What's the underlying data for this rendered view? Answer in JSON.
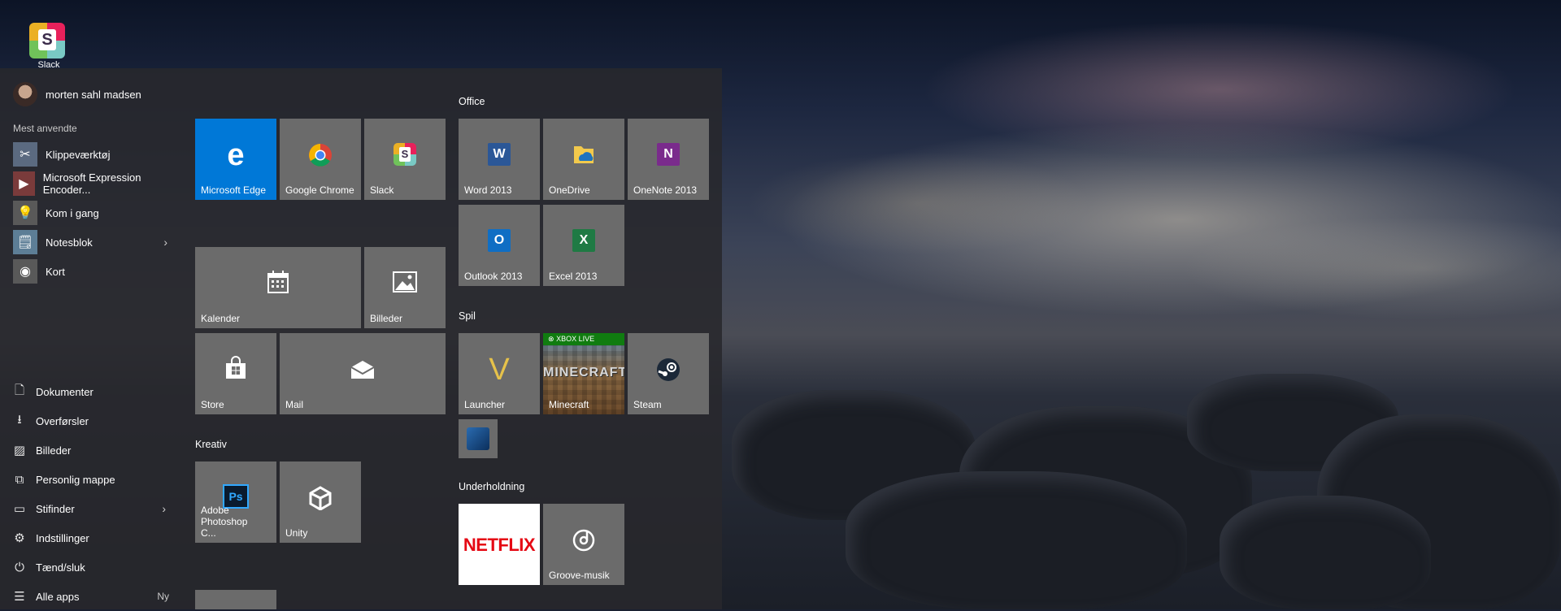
{
  "desktop": {
    "icon_label": "Slack"
  },
  "user": {
    "name": "morten sahl madsen"
  },
  "most_used": {
    "label": "Mest anvendte",
    "items": [
      {
        "label": "Klippeværktøj",
        "icon": "scissors-icon"
      },
      {
        "label": "Microsoft Expression Encoder...",
        "icon": "encoder-icon"
      },
      {
        "label": "Kom i gang",
        "icon": "lightbulb-icon"
      },
      {
        "label": "Notesblok",
        "icon": "notepad-icon"
      },
      {
        "label": "Kort",
        "icon": "map-icon"
      }
    ]
  },
  "system": {
    "items": [
      {
        "label": "Dokumenter",
        "icon": "document-icon"
      },
      {
        "label": "Overførsler",
        "icon": "download-icon"
      },
      {
        "label": "Billeder",
        "icon": "pictures-icon"
      },
      {
        "label": "Personlig mappe",
        "icon": "folder-icon"
      },
      {
        "label": "Stifinder",
        "icon": "explorer-icon"
      },
      {
        "label": "Indstillinger",
        "icon": "gear-icon"
      },
      {
        "label": "Tænd/sluk",
        "icon": "power-icon"
      },
      {
        "label": "Alle apps",
        "icon": "list-icon",
        "badge": "Ny"
      }
    ]
  },
  "tiles": {
    "edge": "Microsoft Edge",
    "chrome": "Google Chrome",
    "slack": "Slack",
    "kalender": "Kalender",
    "billeder": "Billeder",
    "store": "Store",
    "mail": "Mail"
  },
  "groups": {
    "kreativ": {
      "title": "Kreativ",
      "photoshop": "Adobe Photoshop C...",
      "unity": "Unity"
    },
    "office": {
      "title": "Office",
      "word": "Word 2013",
      "onedrive": "OneDrive",
      "onenote": "OneNote 2013",
      "outlook": "Outlook 2013",
      "excel": "Excel 2013"
    },
    "spil": {
      "title": "Spil",
      "launcher": "Launcher",
      "minecraft": "Minecraft",
      "minecraft_badge": "XBOX LIVE",
      "minecraft_logo": "MINECRAFT",
      "steam": "Steam"
    },
    "underholdning": {
      "title": "Underholdning",
      "netflix_logo": "NETFLIX",
      "groove": "Groove-musik"
    }
  },
  "colors": {
    "accent": "#0078d7",
    "tile": "#6b6b6b",
    "netflix_red": "#e50914"
  }
}
